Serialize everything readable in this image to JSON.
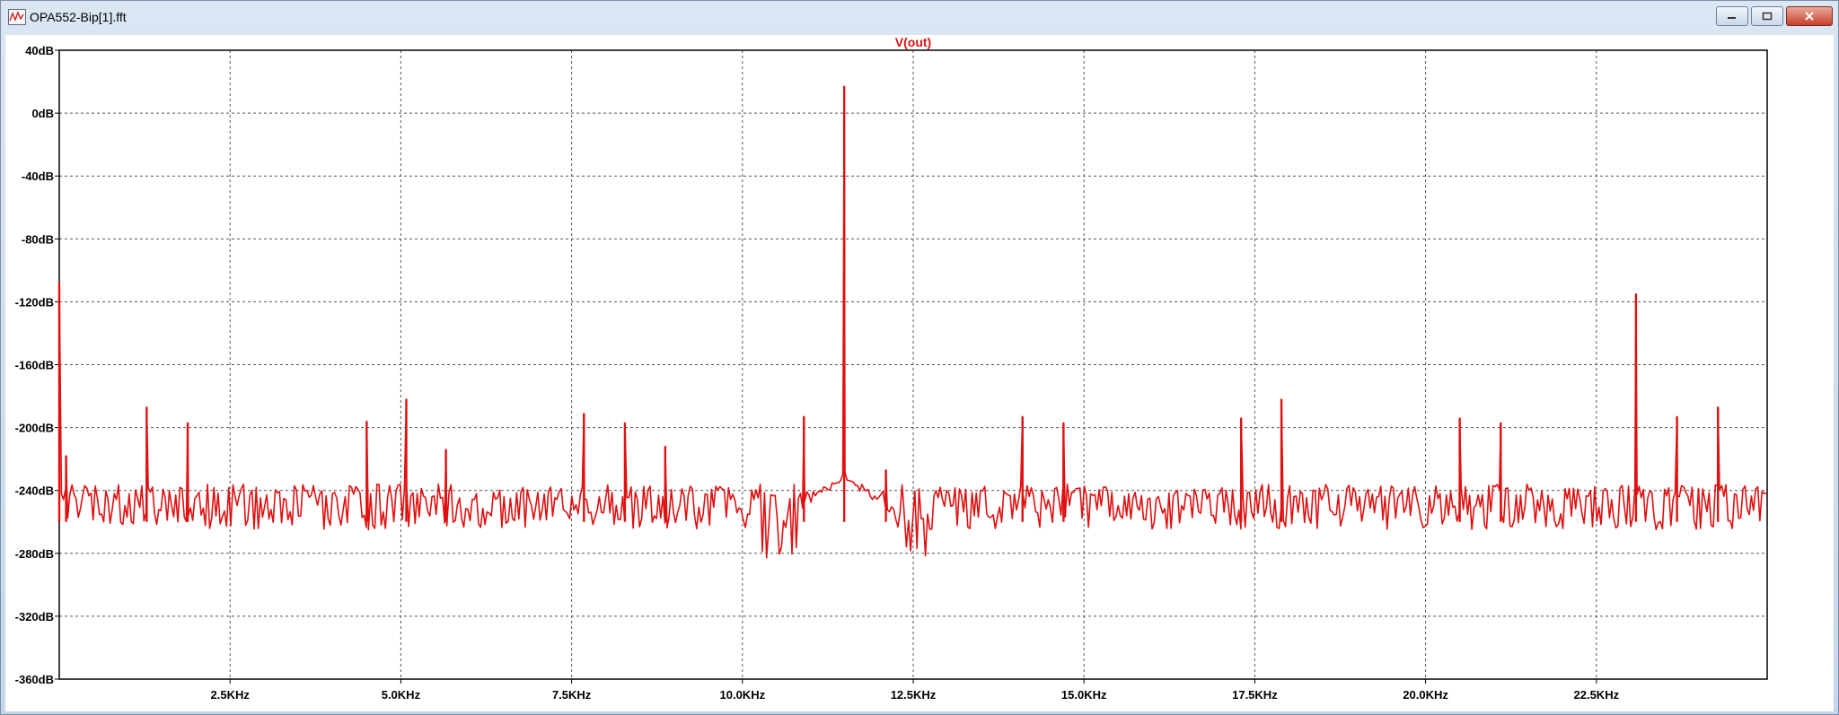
{
  "window": {
    "title": "OPA552-Bip[1].fft",
    "icon": "waveform-icon",
    "buttons": {
      "minimize": "minimize-icon",
      "maximize": "maximize-icon",
      "close": "close-icon"
    }
  },
  "colors": {
    "trace": "#e01010",
    "grid": "#555555",
    "text": "#000000",
    "title": "#e01010"
  },
  "chart_data": {
    "type": "line",
    "title": "V(out)",
    "xlabel": "",
    "ylabel": "",
    "xlim": [
      0,
      25000
    ],
    "ylim": [
      -360,
      40
    ],
    "grid": true,
    "x_ticks": [
      2500,
      5000,
      7500,
      10000,
      12500,
      15000,
      17500,
      20000,
      22500
    ],
    "x_tick_labels": [
      "2.5KHz",
      "5.0KHz",
      "7.5KHz",
      "10.0KHz",
      "12.5KHz",
      "15.0KHz",
      "17.5KHz",
      "20.0KHz",
      "22.5KHz"
    ],
    "y_ticks": [
      40,
      0,
      -40,
      -80,
      -120,
      -160,
      -200,
      -240,
      -280,
      -320,
      -360
    ],
    "y_tick_labels": [
      "40dB",
      "0dB",
      "-40dB",
      "-80dB",
      "-120dB",
      "-160dB",
      "-200dB",
      "-240dB",
      "-280dB",
      "-320dB",
      "-360dB"
    ],
    "noise_floor": {
      "low": -265,
      "high": -236
    },
    "peaks": [
      {
        "x": 0,
        "y": -108
      },
      {
        "x": 100,
        "y": -218
      },
      {
        "x": 1280,
        "y": -187
      },
      {
        "x": 1880,
        "y": -197
      },
      {
        "x": 4500,
        "y": -196
      },
      {
        "x": 5080,
        "y": -182
      },
      {
        "x": 5660,
        "y": -214
      },
      {
        "x": 7680,
        "y": -191
      },
      {
        "x": 8280,
        "y": -197
      },
      {
        "x": 8870,
        "y": -212
      },
      {
        "x": 10900,
        "y": -193
      },
      {
        "x": 11490,
        "y": 17
      },
      {
        "x": 12100,
        "y": -227
      },
      {
        "x": 14100,
        "y": -193
      },
      {
        "x": 14700,
        "y": -197
      },
      {
        "x": 17300,
        "y": -194
      },
      {
        "x": 17890,
        "y": -182
      },
      {
        "x": 20500,
        "y": -194
      },
      {
        "x": 21100,
        "y": -197
      },
      {
        "x": 23080,
        "y": -115
      },
      {
        "x": 23680,
        "y": -193
      },
      {
        "x": 24280,
        "y": -187
      }
    ],
    "series": [
      {
        "name": "V(out)"
      }
    ]
  }
}
